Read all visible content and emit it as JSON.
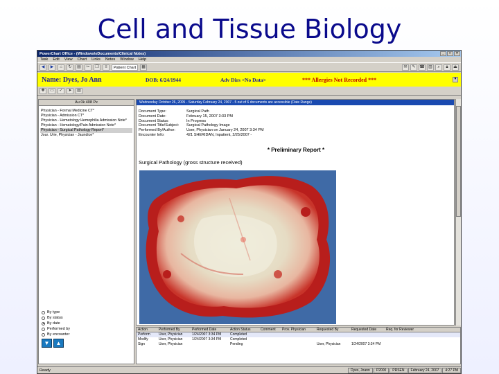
{
  "slide": {
    "title": "Cell and Tissue Biology"
  },
  "window": {
    "title": "PowerChart Office - (Windows\\eDocuments\\Clinical Notes)",
    "menu": [
      "Task",
      "Edit",
      "View",
      "Chart",
      "Links",
      "Notes",
      "Window",
      "Help"
    ],
    "toolbar_text": "Patient Chart",
    "toolbar_icons": [
      "back-arrow-icon",
      "forward-arrow-icon",
      "home-icon",
      "refresh-icon",
      "print-icon",
      "scissors-icon",
      "copy-icon",
      "list-icon",
      "calendar-icon"
    ],
    "toolbar_right_icons": [
      "inbox-icon",
      "mail-icon",
      "phone-icon",
      "chart-icon",
      "search-icon",
      "lock-icon",
      "exit-icon"
    ]
  },
  "banner": {
    "name": "Name: Dyes, Jo Ann",
    "dob": "DOB: 6/24/1944",
    "adv_dirs": "Adv Dirs <No Data>",
    "allergies": "*** Allergies Not Recorded ***"
  },
  "left_panel": {
    "header": "Au 0k 408 Px",
    "notes": [
      "Physician - Formal Medicine CT*",
      "Physician - Admission CT*",
      "Physician - Hematology Hemophilia Admission Note*",
      "Physician - Hematology/Pain Admission Note*",
      "Physician - Surgical Pathology Report*",
      "Jour. Urie, Physician - Jaundice*"
    ],
    "selected_index": 4,
    "radios": [
      "By type",
      "By status",
      "By date",
      "Performed by",
      "By encounter"
    ],
    "radio_selected": 2
  },
  "document": {
    "header": "Wednesday October 26, 2005 - Saturday February 24, 2007 - 5 out of 6 documents are accessible (Date Range)",
    "meta": [
      {
        "key": "Document Type:",
        "value": "Surgical Path"
      },
      {
        "key": "Document Date:",
        "value": "February 15, 2007 3:33 PM"
      },
      {
        "key": "Document Status:",
        "value": "In Progress"
      },
      {
        "key": "Document Title/Subject:",
        "value": "Surgical Pathology Image"
      },
      {
        "key": "Performed By/Author:",
        "value": "User, Physician on January 24, 2007 3:34 PM"
      },
      {
        "key": "Encounter Info:",
        "value": "421 SHERIDAN, Inpatient, 2/25/2007 -"
      }
    ],
    "prelim": "* Preliminary Report *",
    "section": "Surgical Pathology (gross structure received)"
  },
  "grid": {
    "columns": [
      "Action",
      "Performed By",
      "Performed Date",
      "Action Status",
      "Comment",
      "Prov. Physician",
      "Requested By",
      "Requested Date",
      "Req. for Reviewer"
    ],
    "rows": [
      [
        "Perform",
        "User, Physician",
        "1/24/2007 3:34 PM",
        "Completed",
        "",
        "",
        "",
        "",
        ""
      ],
      [
        "Modify",
        "User, Physician",
        "1/24/2007 3:34 PM",
        "Completed",
        "",
        "",
        "",
        "",
        ""
      ],
      [
        "Sign",
        "User, Physician",
        "",
        "Pending",
        "",
        "",
        "User, Physician",
        "1/24/2007 3:34 PM",
        ""
      ]
    ]
  },
  "statusbar": {
    "left": "Ready",
    "cells": [
      "Dyes, Joann",
      "P2000",
      "PRSEN",
      "February 24, 2007",
      "4:27 PM"
    ]
  }
}
